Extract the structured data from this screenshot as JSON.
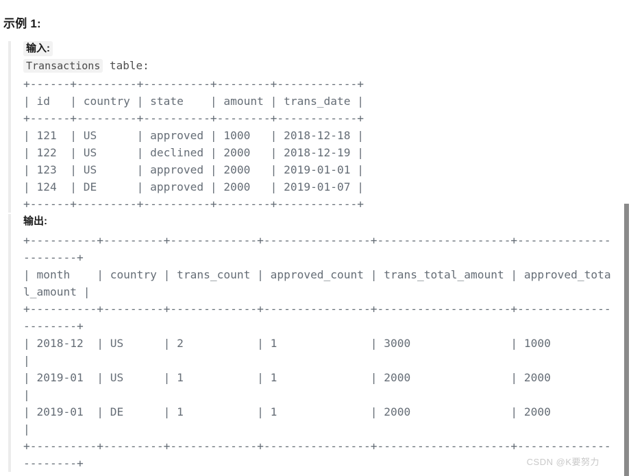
{
  "heading": "示例 1:",
  "input_section": {
    "label": "输入:",
    "table_name": "Transactions",
    "table_suffix": " table:",
    "ascii": "+------+---------+----------+--------+------------+\n| id   | country | state    | amount | trans_date |\n+------+---------+----------+--------+------------+\n| 121  | US      | approved | 1000   | 2018-12-18 |\n| 122  | US      | declined | 2000   | 2018-12-19 |\n| 123  | US      | approved | 2000   | 2019-01-01 |\n| 124  | DE      | approved | 2000   | 2019-01-07 |\n+------+---------+----------+--------+------------+",
    "columns": [
      "id",
      "country",
      "state",
      "amount",
      "trans_date"
    ],
    "rows": [
      [
        "121",
        "US",
        "approved",
        "1000",
        "2018-12-18"
      ],
      [
        "122",
        "US",
        "declined",
        "2000",
        "2018-12-19"
      ],
      [
        "123",
        "US",
        "approved",
        "2000",
        "2019-01-01"
      ],
      [
        "124",
        "DE",
        "approved",
        "2000",
        "2019-01-07"
      ]
    ]
  },
  "output_section": {
    "label": "输出:",
    "ascii": "+----------+---------+-------------+----------------+--------------------+----------------------+\n| month    | country | trans_count | approved_count | trans_total_amount | approved_total_amount |\n+----------+---------+-------------+----------------+--------------------+----------------------+\n| 2018-12  | US      | 2           | 1              | 3000               | 1000                 |\n| 2019-01  | US      | 1           | 1              | 2000               | 2000                 |\n| 2019-01  | DE      | 1           | 1              | 2000               | 2000                 |\n+----------+---------+-------------+----------------+--------------------+----------------------+",
    "columns": [
      "month",
      "country",
      "trans_count",
      "approved_count",
      "trans_total_amount",
      "approved_total_amount"
    ],
    "rows": [
      [
        "2018-12",
        "US",
        "2",
        "1",
        "3000",
        "1000"
      ],
      [
        "2019-01",
        "US",
        "1",
        "1",
        "2000",
        "2000"
      ],
      [
        "2019-01",
        "DE",
        "1",
        "1",
        "2000",
        "2000"
      ]
    ]
  },
  "watermark": "CSDN @K要努力",
  "colors": {
    "text": "#1a1a1a",
    "code_text": "#656d76",
    "inline_code_bg": "#f2f2f2",
    "blockquote_border": "#ececec",
    "watermark": "#c9c9c9",
    "scrollbar_thumb": "#8a8a8a"
  }
}
